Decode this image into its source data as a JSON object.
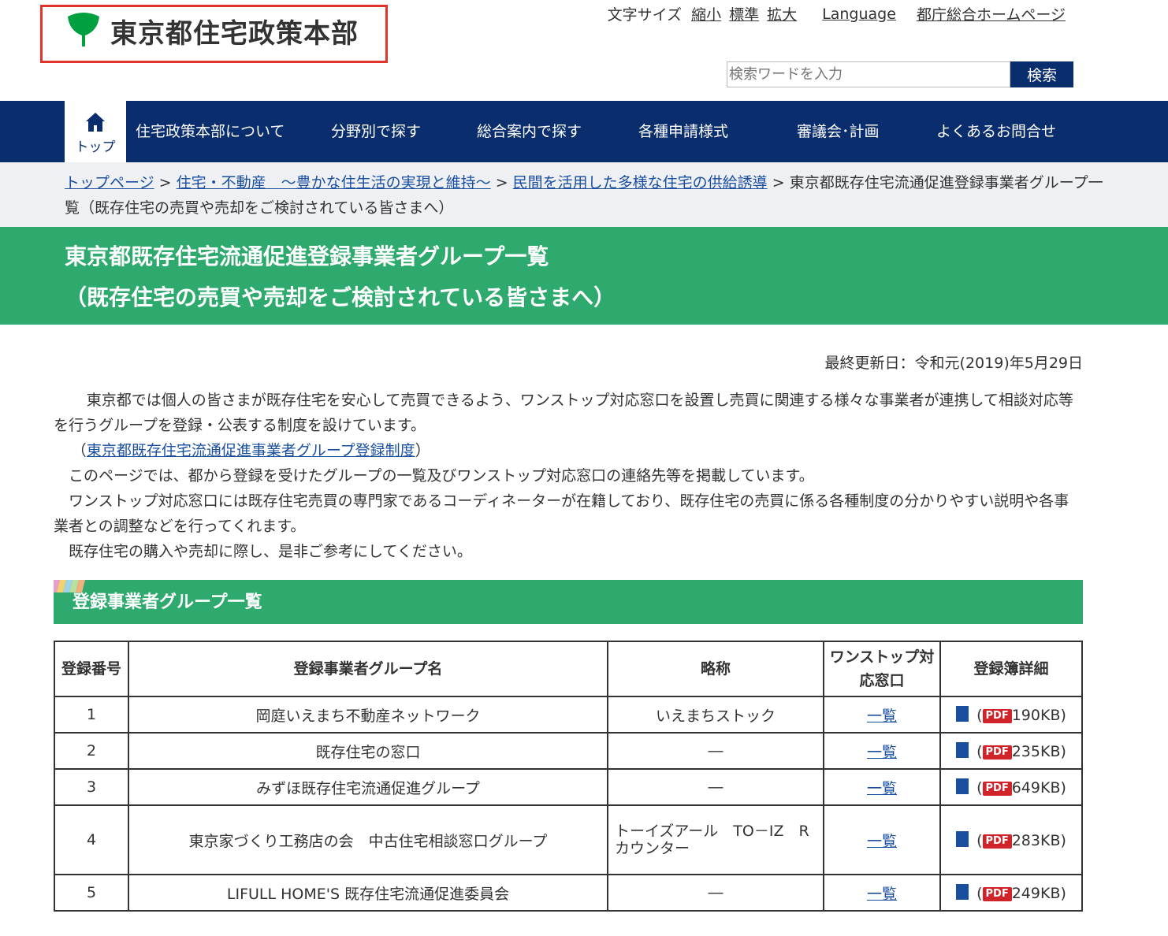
{
  "header": {
    "site_title": "東京都住宅政策本部",
    "font_size_label": "文字サイズ",
    "font_small": "縮小",
    "font_standard": "標準",
    "font_large": "拡大",
    "language": "Language",
    "gov_home": "都庁総合ホームページ",
    "search_placeholder": "検索ワードを入力",
    "search_button": "検索"
  },
  "gnav": {
    "home": "トップ",
    "items": [
      "住宅政策本部について",
      "分野別で探す",
      "総合案内で探す",
      "各種申請様式",
      "審議会･計画",
      "よくあるお問合せ"
    ]
  },
  "breadcrumb": {
    "items": [
      "トップページ",
      "住宅・不動産　～豊かな住生活の実現と維持～",
      "民間を活用した多様な住宅の供給誘導"
    ],
    "current": "東京都既存住宅流通促進登録事業者グループ一覧（既存住宅の売買や売却をご検討されている皆さまへ）",
    "sep": ">"
  },
  "page_title": {
    "line1": "東京都既存住宅流通促進登録事業者グループ一覧",
    "line2": "（既存住宅の売買や売却をご検討されている皆さまへ）"
  },
  "updated": "最終更新日：令和元(2019)年5月29日",
  "body": {
    "p1": "　東京都では個人の皆さまが既存住宅を安心して売買できるよう、ワンストップ対応窓口を設置し売買に関連する様々な事業者が連携して相談対応等を行うグループを登録・公表する制度を設けています。",
    "p2_open": "（",
    "p2_link": "東京都既存住宅流通促進事業者グループ登録制度",
    "p2_close": "）",
    "p3": "このページでは、都から登録を受けたグループの一覧及びワンストップ対応窓口の連絡先等を掲載しています。",
    "p4": "ワンストップ対応窓口には既存住宅売買の専門家であるコーディネーターが在籍しており、既存住宅の売買に係る各種制度の分かりやすい説明や各事業者との調整などを行ってくれます。",
    "p5": "既存住宅の購入や売却に際し、是非ご参考にしてください。"
  },
  "section_title": "登録事業者グループ一覧",
  "table": {
    "headers": [
      "登録番号",
      "登録事業者グループ名",
      "略称",
      "ワンストップ対応窓口",
      "登録簿詳細"
    ],
    "pdf_label": "PDF",
    "list_link": "一覧",
    "rows": [
      {
        "no": "1",
        "name": "岡庭いえまち不動産ネットワーク",
        "abbr": "いえまちストック",
        "size": "190KB"
      },
      {
        "no": "2",
        "name": "既存住宅の窓口",
        "abbr": "―",
        "size": "235KB"
      },
      {
        "no": "3",
        "name": "みずほ既存住宅流通促進グループ",
        "abbr": "―",
        "size": "649KB"
      },
      {
        "no": "4",
        "name": "東京家づくり工務店の会　中古住宅相談窓口グループ",
        "abbr": "トーイズアール　TO－IZ　R　カウンター",
        "size": "283KB"
      },
      {
        "no": "5",
        "name": "LIFULL HOME'S 既存住宅流通促進委員会",
        "abbr": "―",
        "size": "249KB"
      }
    ]
  },
  "colors": {
    "navy": "#0a2d6e",
    "green": "#2eaa6e",
    "highlight_red": "#e0332c",
    "pdf_red": "#d1232a"
  }
}
